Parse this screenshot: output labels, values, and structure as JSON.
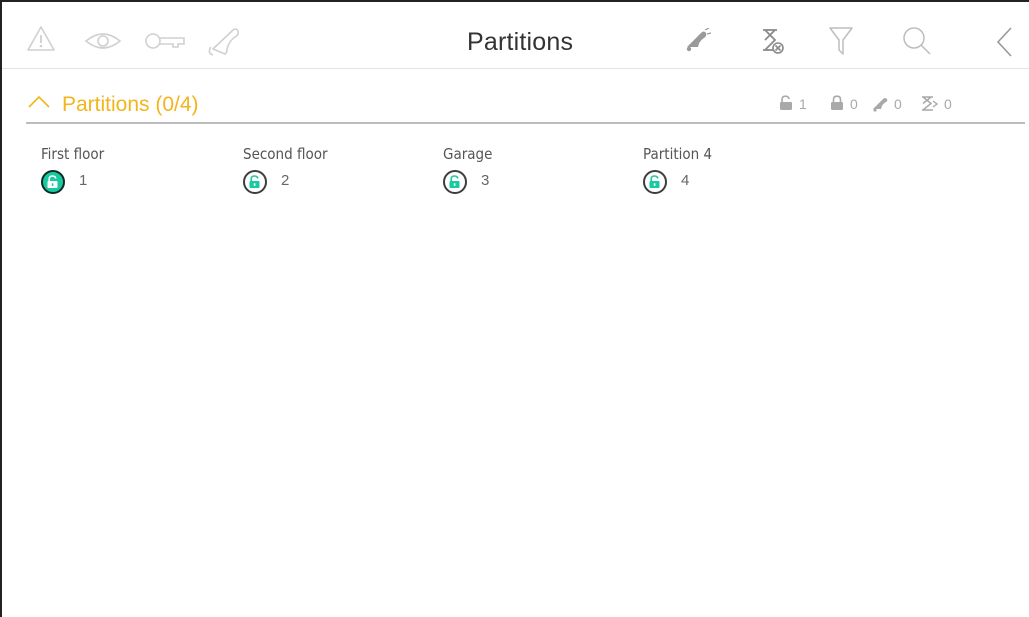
{
  "header": {
    "title": "Partitions",
    "left_icons": [
      "alarm-warning-icon",
      "eye-icon",
      "key-icon",
      "bell-icon"
    ],
    "right_icons": [
      "silence-bell-icon",
      "hourglass-cancel-icon",
      "filter-icon",
      "search-icon",
      "back-chevron-icon"
    ]
  },
  "section": {
    "title": "Partitions (0/4)",
    "stats": [
      {
        "icon": "unlocked-icon",
        "value": "1"
      },
      {
        "icon": "locked-icon",
        "value": "0"
      },
      {
        "icon": "silenced-bell-icon",
        "value": "0"
      },
      {
        "icon": "delay-hourglass-icon",
        "value": "0"
      }
    ]
  },
  "partitions": [
    {
      "name": "First floor",
      "number": "1",
      "status": "disarmed"
    },
    {
      "name": "Second floor",
      "number": "2",
      "status": "disarmed"
    },
    {
      "name": "Garage",
      "number": "3",
      "status": "disarmed"
    },
    {
      "name": "Partition 4",
      "number": "4",
      "status": "disarmed"
    }
  ],
  "colors": {
    "accent": "#f2b51c",
    "teal": "#19c9a0",
    "icon_light": "#d0d0d0",
    "icon_dark": "#9a9a9a",
    "text": "#333333"
  }
}
